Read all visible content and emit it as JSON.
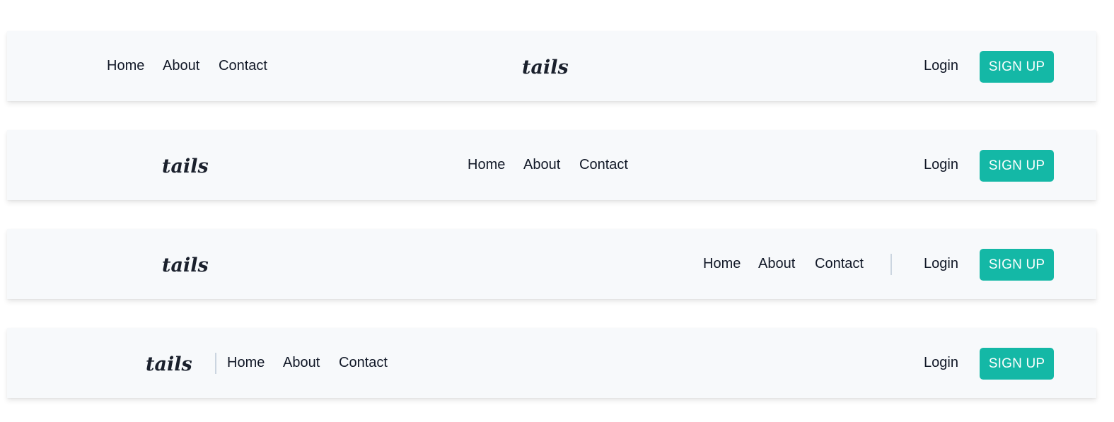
{
  "brand": {
    "logo_text": "tails"
  },
  "colors": {
    "accent": "#14b8a6",
    "background": "#f7f9fb",
    "text": "#111827",
    "divider": "#cbd5e0"
  },
  "navbars": [
    {
      "links": [
        "Home",
        "About",
        "Contact"
      ],
      "login_label": "Login",
      "signup_label": "SIGN UP"
    },
    {
      "links": [
        "Home",
        "About",
        "Contact"
      ],
      "login_label": "Login",
      "signup_label": "SIGN UP"
    },
    {
      "links": [
        "Home",
        "About",
        "Contact"
      ],
      "login_label": "Login",
      "signup_label": "SIGN UP"
    },
    {
      "links": [
        "Home",
        "About",
        "Contact"
      ],
      "login_label": "Login",
      "signup_label": "SIGN UP"
    }
  ]
}
